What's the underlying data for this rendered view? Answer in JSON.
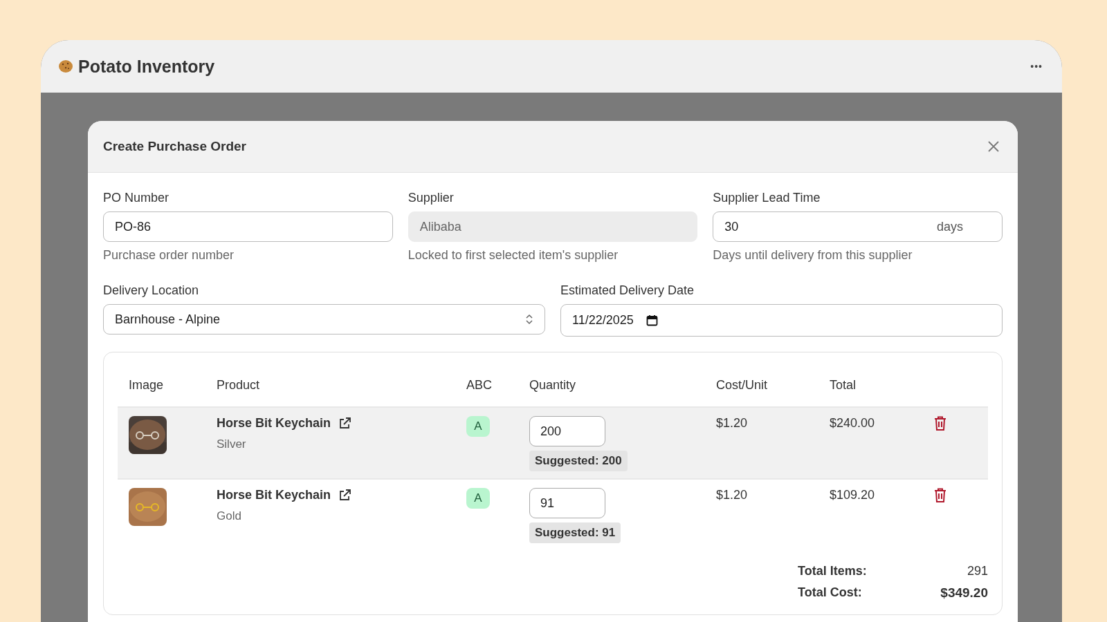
{
  "app": {
    "title": "Potato Inventory",
    "menu": "•••"
  },
  "dialog": {
    "title": "Create Purchase Order",
    "fields": [
      {
        "label": "PO Number",
        "value": "PO-86",
        "help": "Purchase order number",
        "disabled": false
      },
      {
        "label": "Supplier",
        "value": "Alibaba",
        "help": "Locked to first selected item's supplier",
        "disabled": true
      },
      {
        "label": "Supplier Lead Time",
        "value": "30",
        "unit": "days",
        "help": "Days until delivery from this supplier",
        "disabled": false
      }
    ],
    "delivery_location": {
      "label": "Delivery Location",
      "value": "Barnhouse - Alpine"
    },
    "delivery_date": {
      "label": "Estimated Delivery Date",
      "value": "11/22/2025"
    },
    "table": {
      "columns": [
        "Image",
        "Product",
        "ABC",
        "Quantity",
        "Cost/Unit",
        "Total"
      ],
      "rows": [
        {
          "product": "Horse Bit Keychain",
          "variant": "Silver",
          "abc": "A",
          "quantity": "200",
          "suggested": "Suggested: 200",
          "cost": "$1.20",
          "total": "$240.00",
          "selected": true
        },
        {
          "product": "Horse Bit Keychain",
          "variant": "Gold",
          "abc": "A",
          "quantity": "91",
          "suggested": "Suggested: 91",
          "cost": "$1.20",
          "total": "$109.20",
          "selected": false
        }
      ]
    },
    "summary": [
      {
        "label": "Total Items:",
        "value": "291",
        "kind": "count"
      },
      {
        "label": "Total Cost:",
        "value": "$349.20",
        "kind": "money"
      }
    ]
  }
}
